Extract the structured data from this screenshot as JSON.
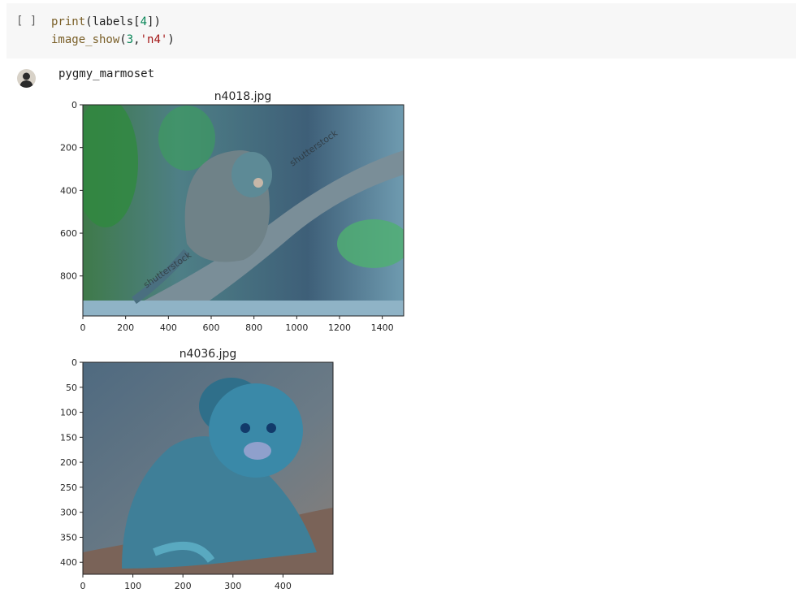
{
  "cell": {
    "run_indicator": "[ ]",
    "code_line1": {
      "fn": "print",
      "open": "(labels[",
      "num": "4",
      "close": "])"
    },
    "code_line2": {
      "fn": "image_show",
      "open": "(",
      "num": "3",
      "sep": ",",
      "str": "'n4'",
      "close": ")"
    }
  },
  "output": {
    "stdout": "pygmy_marmoset",
    "watermark": "shutterstock"
  },
  "chart_data": [
    {
      "type": "image",
      "title": "n4018.jpg",
      "xlim": [
        0,
        1500
      ],
      "ylim": [
        987,
        0
      ],
      "xticks": [
        0,
        200,
        400,
        600,
        800,
        1000,
        1200,
        1400
      ],
      "yticks": [
        0,
        200,
        400,
        600,
        800
      ]
    },
    {
      "type": "image",
      "title": "n4036.jpg",
      "xlim": [
        0,
        500
      ],
      "ylim": [
        424,
        0
      ],
      "xticks": [
        0,
        100,
        200,
        300,
        400
      ],
      "yticks": [
        0,
        50,
        100,
        150,
        200,
        250,
        300,
        350,
        400
      ]
    }
  ]
}
